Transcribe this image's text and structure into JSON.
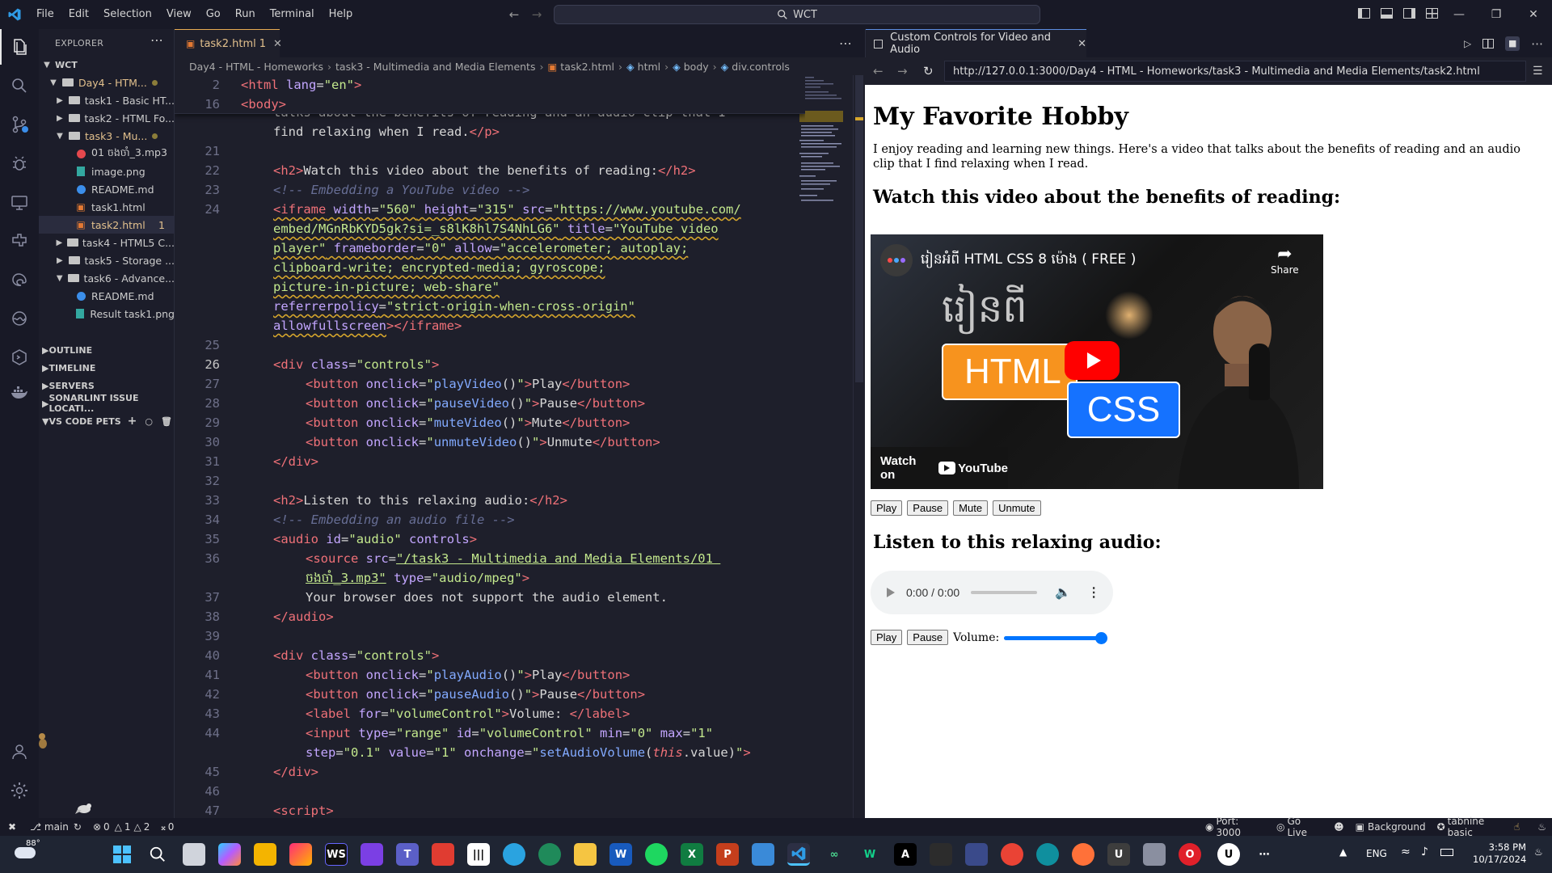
{
  "menu": [
    "File",
    "Edit",
    "Selection",
    "View",
    "Go",
    "Run",
    "Terminal",
    "Help"
  ],
  "command_center": "WCT",
  "explorer": {
    "title": "EXPLORER",
    "root": "WCT",
    "items": [
      {
        "label": "Day4 - HTM...",
        "type": "folder-open",
        "depth": 1,
        "color": "#e2c08d"
      },
      {
        "label": "task1 - Basic HT...",
        "type": "folder",
        "depth": 2,
        "color": "#cccccc"
      },
      {
        "label": "task2 - HTML Fo...",
        "type": "folder",
        "depth": 2,
        "color": "#cccccc"
      },
      {
        "label": "task3 - Mu...",
        "type": "folder-open",
        "depth": 2,
        "color": "#e2c08d"
      },
      {
        "label": "01 ចងចាំ_3.mp3",
        "type": "error-file",
        "depth": 3,
        "color": "#cccccc"
      },
      {
        "label": "image.png",
        "type": "image",
        "depth": 3,
        "color": "#cccccc"
      },
      {
        "label": "README.md",
        "type": "info",
        "depth": 3,
        "color": "#cccccc"
      },
      {
        "label": "task1.html",
        "type": "html",
        "depth": 3,
        "color": "#cccccc"
      },
      {
        "label": "task2.html",
        "type": "html",
        "depth": 3,
        "color": "#e2c08d",
        "badge": "1"
      },
      {
        "label": "task4 - HTML5 C...",
        "type": "folder",
        "depth": 2,
        "color": "#cccccc"
      },
      {
        "label": "task5 - Storage ...",
        "type": "folder",
        "depth": 2,
        "color": "#cccccc"
      },
      {
        "label": "task6 - Advance...",
        "type": "folder-open",
        "depth": 2,
        "color": "#cccccc"
      },
      {
        "label": "README.md",
        "type": "info",
        "depth": 3,
        "color": "#cccccc"
      },
      {
        "label": "Result task1.png",
        "type": "image",
        "depth": 3,
        "color": "#cccccc"
      }
    ],
    "sections": [
      "OUTLINE",
      "TIMELINE",
      "SERVERS",
      "SONARLINT ISSUE LOCATI...",
      "VS CODE PETS"
    ]
  },
  "editor": {
    "tab_label": "task2.html",
    "tab_badge": "1",
    "breadcrumb": [
      "Day4 - HTML - Homeworks",
      "task3 - Multimedia and Media Elements",
      "task2.html",
      "html",
      "body",
      "div.controls"
    ]
  },
  "preview": {
    "tab_label": "Custom Controls for Video and Audio",
    "url": "http://127.0.0.1:3000/Day4 - HTML - Homeworks/task3 - Multimedia and Media Elements/task2.html",
    "page": {
      "h1": "My Favorite Hobby",
      "intro": "I enjoy reading and learning new things. Here's a video that talks about the benefits of reading and an audio clip that I find relaxing when I read.",
      "video_heading": "Watch this video about the benefits of reading:",
      "video_title": "រៀនអំពី HTML CSS 8 ម៉ោង ( FREE )",
      "video_overlay_text": "រៀនពី",
      "video_share": "Share",
      "video_watch_on": "Watch on",
      "video_brand": "YouTube",
      "video_badge_html": "HTML",
      "video_badge_css": "CSS",
      "video_buttons": [
        "Play",
        "Pause",
        "Mute",
        "Unmute"
      ],
      "audio_heading": "Listen to this relaxing audio:",
      "audio_time": "0:00 / 0:00",
      "audio_buttons": [
        "Play",
        "Pause"
      ],
      "volume_label": "Volume:",
      "volume_value": 1
    }
  },
  "status": {
    "branch": "main",
    "errors": "0",
    "warnings": "1",
    "warnings2": "2",
    "ports": "0",
    "port": "Port: 3000",
    "golive": "Go Live",
    "background": "Background",
    "tabnine": "tabnine basic"
  },
  "taskbar": {
    "weather": "88°",
    "lang": "ENG",
    "time": "3:58 PM",
    "date": "10/17/2024"
  },
  "colors": {
    "accent_tab": "#e8ab53",
    "preview_accent": "#5c8de0",
    "youtube_red": "#ff0000",
    "html_orange": "#f7931e",
    "css_blue": "#1572ff"
  }
}
